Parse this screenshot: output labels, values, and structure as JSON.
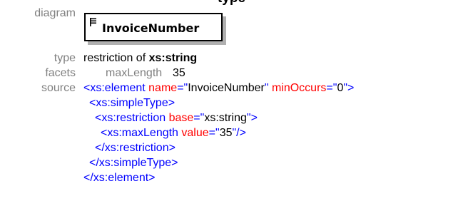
{
  "header": {
    "clipped_title": "type"
  },
  "labels": {
    "diagram": "diagram",
    "type": "type",
    "facets": "facets",
    "source": "source"
  },
  "diagram": {
    "element_name": "InvoiceNumber"
  },
  "type_info": {
    "prefix": "restriction of ",
    "base": "xs:string"
  },
  "facets": [
    {
      "name": "maxLength",
      "value": "35"
    }
  ],
  "source": {
    "line1": {
      "open": "<xs:element ",
      "attr1": "name",
      "eq1": "=\"",
      "val1": "InvoiceNumber",
      "q1": "\" ",
      "attr2": "minOccurs",
      "eq2": "=\"",
      "val2": "0",
      "q2": "\"",
      "close": ">"
    },
    "line2": "<xs:simpleType>",
    "line3": {
      "open": "<xs:restriction ",
      "attr": "base",
      "eq": "=\"",
      "val": "xs:string",
      "q": "\"",
      "close": ">"
    },
    "line4": {
      "open": "<xs:maxLength ",
      "attr": "value",
      "eq": "=\"",
      "val": "35",
      "q": "\"",
      "close": "/>"
    },
    "line5": "</xs:restriction>",
    "line6": "</xs:simpleType>",
    "line7": "</xs:element>"
  },
  "colors": {
    "label": "#808080",
    "tag": "#0000ff",
    "attribute": "#ff0000",
    "shadow": "#b0b0b0"
  }
}
